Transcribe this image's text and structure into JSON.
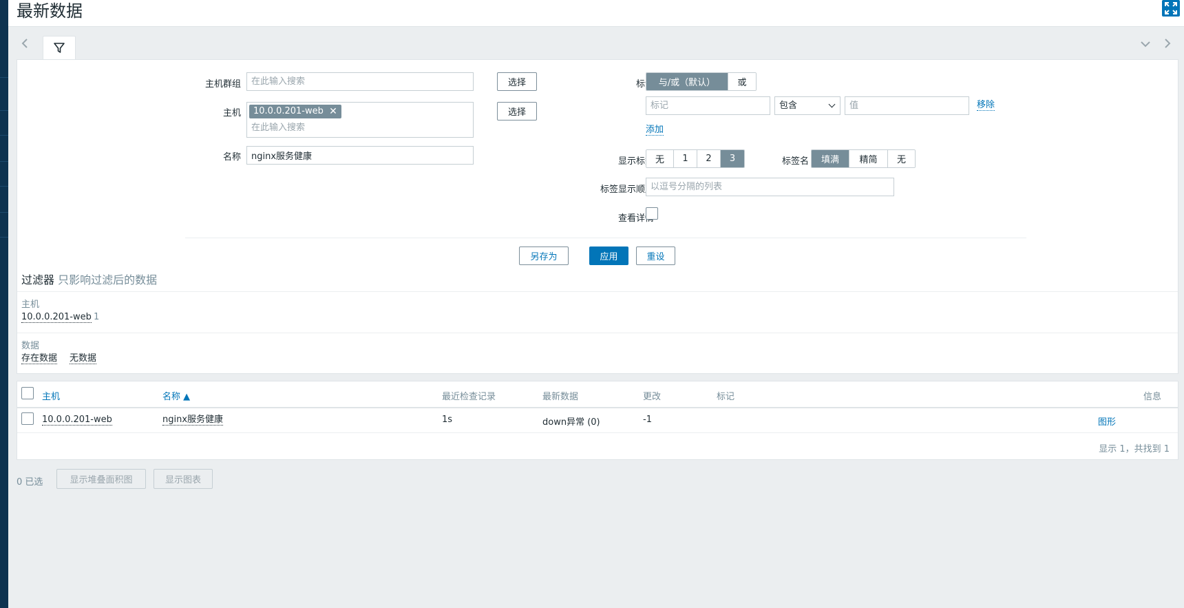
{
  "header": {
    "title": "最新数据",
    "fullscreen_icon": "fullscreen-icon"
  },
  "tabs": {
    "prev_icon": "chevron-left-icon",
    "filter_icon": "filter-icon",
    "collapse_icon": "chevron-down-icon",
    "next_icon": "chevron-right-icon"
  },
  "filter": {
    "host_groups_label": "主机群组",
    "host_groups_placeholder": "在此输入搜索",
    "select_label": "选择",
    "hosts_label": "主机",
    "host_chip": "10.0.0.201-web",
    "hosts_placeholder": "在此输入搜索",
    "name_label": "名称",
    "name_value": "nginx服务健康",
    "tags_label": "标记",
    "tags_operator": [
      "与/或（默认）",
      "或"
    ],
    "tag_placeholder": "标记",
    "tag_condition": "包含",
    "tag_value_placeholder": "值",
    "remove_label": "移除",
    "add_label": "添加",
    "show_tags_label": "显示标签",
    "show_tags_options": [
      "无",
      "1",
      "2",
      "3"
    ],
    "tag_name_label": "标签名",
    "tag_name_options": [
      "填满",
      "精简",
      "无"
    ],
    "tag_order_label": "标签显示顺序",
    "tag_order_placeholder": "以逗号分隔的列表",
    "show_details_label": "查看详情",
    "save_as_label": "另存为",
    "apply_label": "应用",
    "reset_label": "重设"
  },
  "summary": {
    "title": "过滤器",
    "subtitle": "只影响过滤后的数据",
    "host_label": "主机",
    "host_value": "10.0.0.201-web",
    "host_count": "1",
    "data_label": "数据",
    "data_values": [
      "存在数据",
      "无数据"
    ]
  },
  "table": {
    "columns": [
      "主机",
      "名称 ▲",
      "最近检查记录",
      "最新数据",
      "更改",
      "标记",
      "信息"
    ],
    "rows": [
      {
        "host": "10.0.0.201-web",
        "name": "nginx服务健康",
        "last_check": "1s",
        "last_value": "down异常 (0)",
        "change": "-1",
        "tags": "",
        "graph_link": "图形"
      }
    ],
    "footer": "显示 1，共找到 1"
  },
  "actions": {
    "selected": "0 已选",
    "stacked_graph": "显示堆叠面积图",
    "graph": "显示图表"
  },
  "colors": {
    "accent": "#0275b8",
    "sidebar": "#0e3350",
    "active_segment": "#768d99"
  }
}
